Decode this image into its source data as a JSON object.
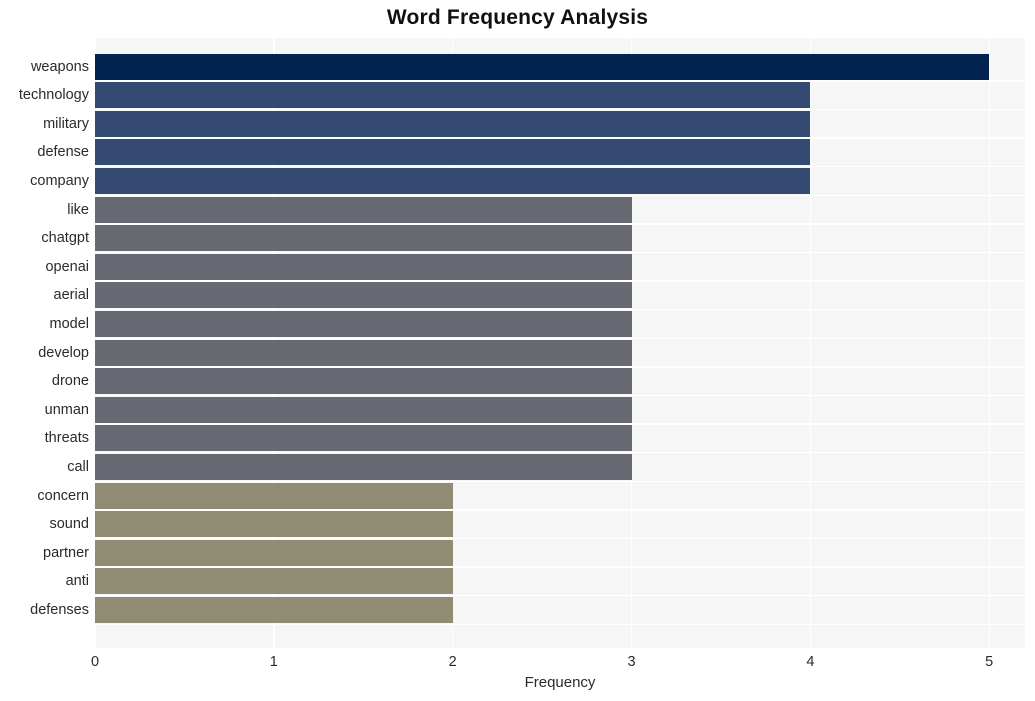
{
  "chart_data": {
    "type": "bar",
    "orientation": "horizontal",
    "title": "Word Frequency Analysis",
    "xlabel": "Frequency",
    "ylabel": "",
    "xlim": [
      0,
      5.2
    ],
    "xticks": [
      0,
      1,
      2,
      3,
      4,
      5
    ],
    "xtick_labels": [
      "0",
      "1",
      "2",
      "3",
      "4",
      "5"
    ],
    "grid": true,
    "grid_axis": "both",
    "legend": false,
    "categories": [
      "weapons",
      "technology",
      "military",
      "defense",
      "company",
      "like",
      "chatgpt",
      "openai",
      "aerial",
      "model",
      "develop",
      "drone",
      "unman",
      "threats",
      "call",
      "concern",
      "sound",
      "partner",
      "anti",
      "defenses"
    ],
    "values": [
      5,
      4,
      4,
      4,
      4,
      3,
      3,
      3,
      3,
      3,
      3,
      3,
      3,
      3,
      3,
      2,
      2,
      2,
      2,
      2
    ],
    "bar_colors": [
      "#02224f",
      "#344a72",
      "#344a72",
      "#344a72",
      "#344a72",
      "#676a73",
      "#676a73",
      "#676a73",
      "#676a73",
      "#676a73",
      "#676a73",
      "#676a73",
      "#676a73",
      "#676a73",
      "#676a73",
      "#908c74",
      "#908c74",
      "#908c74",
      "#908c74",
      "#908c74"
    ],
    "palette": {
      "value_5": "#02224f",
      "value_4": "#344a72",
      "value_3": "#676a73",
      "value_2": "#908c74"
    },
    "figure_background": "#ffffff",
    "plot_background": "#f6f6f7",
    "gridline_color": "#ffffff"
  }
}
